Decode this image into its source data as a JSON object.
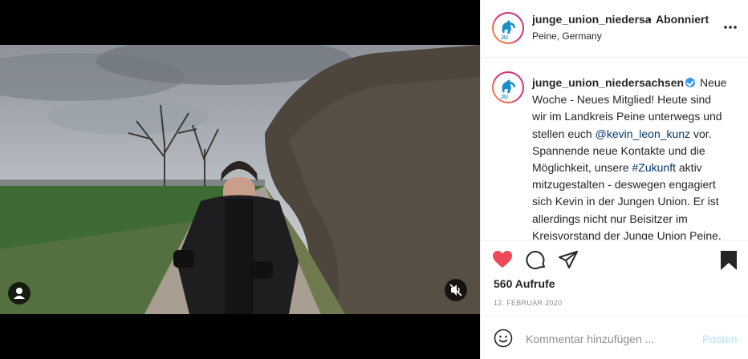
{
  "post": {
    "username": "junge_union_niedersachsen",
    "username_truncated": "junge_union_niedersac",
    "separator": "•",
    "follow_state": "Abonniert",
    "location": "Peine, Germany",
    "caption": {
      "username": "junge_union_niedersachsen",
      "text_1": " Neue Woche - Neues Mitglied! Heute sind wir im Landkreis Peine unterwegs und stellen euch ",
      "mention": "@kevin_leon_kunz",
      "text_2": " vor. Spannende neue Kontakte und die Möglichkeit, unsere ",
      "hashtag": "#Zukunft",
      "text_3": " aktiv mitzugestalten - deswegen engagiert sich Kevin in der Jungen Union. Er ist allerdings nicht nur Beisitzer im Kreisvorstand der Junge Union Peine, sondern wirkt auch in seinem CDU"
    },
    "views": "560 Aufrufe",
    "date": "12. FEBRUAR 2020",
    "liked": true,
    "like_color": "#ed4956"
  },
  "comment": {
    "placeholder": "Kommentar hinzufügen ...",
    "post_label": "Posten"
  },
  "icons": {
    "avatar": "ju-horse-logo",
    "more": "more-horizontal-icon",
    "like": "heart-icon",
    "comment": "comment-icon",
    "share": "paper-plane-icon",
    "save": "bookmark-icon",
    "user_tag": "user-tag-icon",
    "mute": "muted-speaker-icon",
    "emoji": "smiley-icon"
  }
}
